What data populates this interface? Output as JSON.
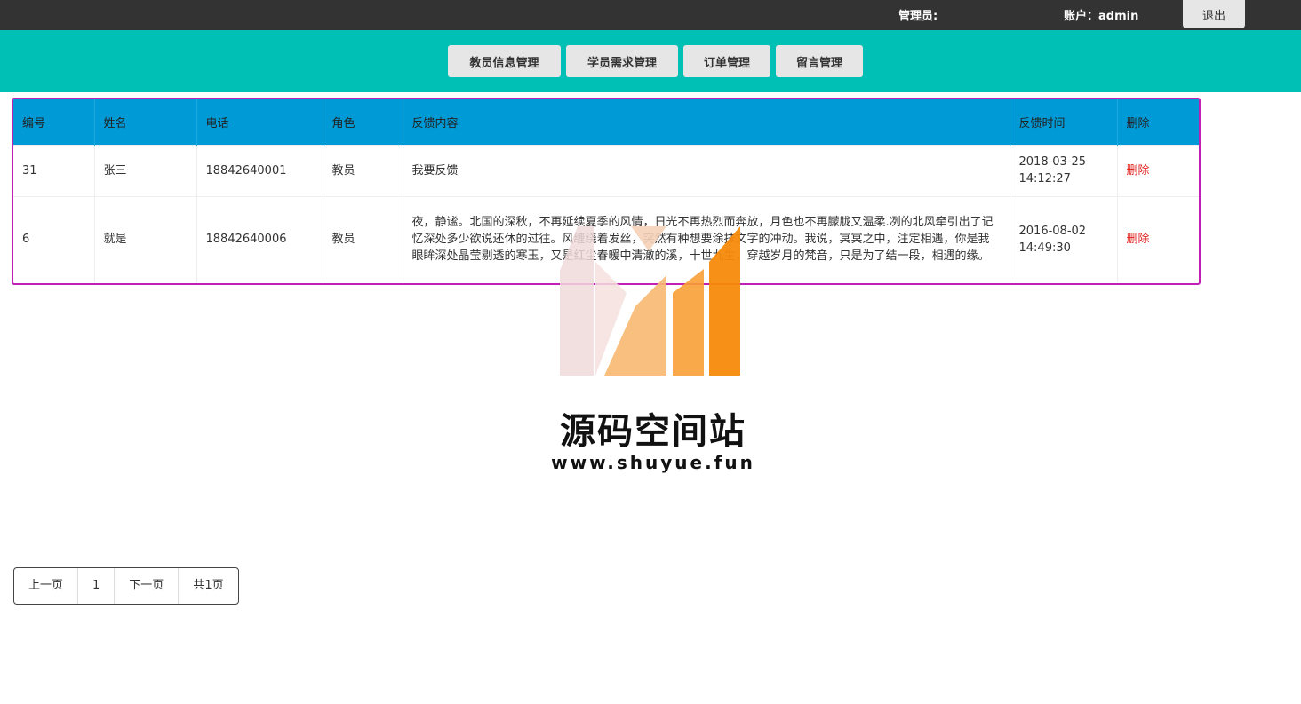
{
  "topbar": {
    "admin_label": "管理员:",
    "account_label": "账户：admin",
    "logout_label": "退出"
  },
  "nav": {
    "items": [
      {
        "label": "教员信息管理"
      },
      {
        "label": "学员需求管理"
      },
      {
        "label": "订单管理"
      },
      {
        "label": "留言管理"
      }
    ]
  },
  "table": {
    "headers": [
      "编号",
      "姓名",
      "电话",
      "角色",
      "反馈内容",
      "反馈时间",
      "删除"
    ],
    "rows": [
      {
        "id": "31",
        "name": "张三",
        "phone": "18842640001",
        "role": "教员",
        "content": "我要反馈",
        "time": "2018-03-25 14:12:27",
        "delete_label": "删除"
      },
      {
        "id": "6",
        "name": "就是",
        "phone": "18842640006",
        "role": "教员",
        "content": "夜，静谧。北国的深秋，不再延续夏季的风情，日光不再热烈而奔放，月色也不再朦胧又温柔.冽的北风牵引出了记忆深处多少欲说还休的过往。风缠绕着发丝，突然有种想要涂抹文字的冲动。我说，冥冥之中，注定相遇，你是我眼眸深处晶莹剔透的寒玉，又是红尘春暖中清澈的溪，十世九生，穿越岁月的梵音，只是为了结一段，相遇的缘。",
        "time": "2016-08-02 14:49:30",
        "delete_label": "删除"
      }
    ]
  },
  "watermark": {
    "title": "源码空间站",
    "url": "www.shuyue.fun"
  },
  "pager": {
    "prev": "上一页",
    "current": "1",
    "next": "下一页",
    "total": "共1页"
  },
  "colors": {
    "topbar": "#333333",
    "navbar": "#00bfb5",
    "table_header": "#009ad6",
    "table_border": "#c21fb6",
    "delete_link": "#e0201d"
  }
}
